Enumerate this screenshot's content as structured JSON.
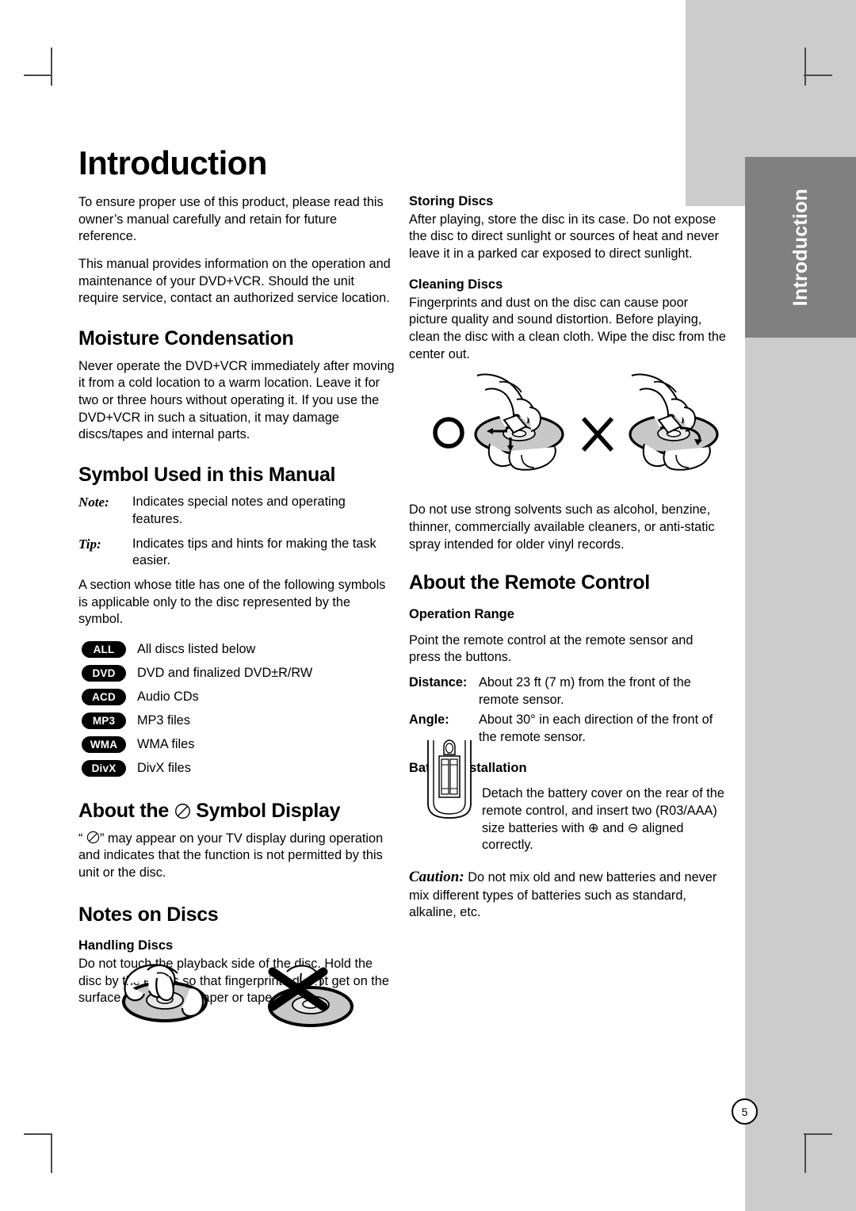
{
  "page": {
    "number": "5",
    "side_tab": "Introduction",
    "colors": {
      "tab_background": "#808080",
      "panel_gray": "#cccccc",
      "text": "#000000",
      "badge_background": "#000000",
      "badge_text": "#ffffff"
    }
  },
  "left_column": {
    "title": "Introduction",
    "intro_p1": "To ensure proper use of this product, please read this owner’s manual carefully and retain for future reference.",
    "intro_p2": "This manual provides information on the operation and maintenance of your DVD+VCR. Should the unit require service, contact an authorized service location.",
    "moisture": {
      "heading": "Moisture Condensation",
      "body": "Never operate the DVD+VCR immediately after moving it from a cold location to a warm location. Leave it for two or three hours without operating it. If you use the DVD+VCR in such a situation, it may damage discs/tapes and internal parts."
    },
    "symbol_manual": {
      "heading": "Symbol Used in this Manual",
      "definitions": [
        {
          "term": "Note:",
          "desc": "Indicates special notes and operating features."
        },
        {
          "term": "Tip:",
          "desc": "Indicates tips and hints for making the task easier."
        }
      ],
      "applicability": "A section whose title has one of the following symbols is applicable only to the disc represented by the symbol.",
      "badges": [
        {
          "code": "ALL",
          "desc": "All discs listed below"
        },
        {
          "code": "DVD",
          "desc": "DVD and finalized DVD±R/RW"
        },
        {
          "code": "ACD",
          "desc": "Audio CDs"
        },
        {
          "code": "MP3",
          "desc": "MP3 files"
        },
        {
          "code": "WMA",
          "desc": "WMA files"
        },
        {
          "code": "DivX",
          "desc": "DivX files"
        }
      ]
    },
    "symbol_display": {
      "heading_before": "About the",
      "heading_after": "Symbol Display",
      "body_before": "“",
      "body_after": "” may appear on your TV display during operation and indicates that the function is not permitted by this unit or the disc."
    },
    "notes_on_discs": {
      "heading": "Notes on Discs",
      "handling": {
        "heading": "Handling Discs",
        "body": "Do not touch the playback side of the disc. Hold the disc by the edges so that fingerprints do not get on the surface. Never stick paper or tape on the disc."
      }
    }
  },
  "right_column": {
    "storing": {
      "heading": "Storing Discs",
      "body": "After playing, store the disc in its case. Do not expose the disc to direct sunlight or sources of heat and never leave it in a parked car exposed to direct sunlight."
    },
    "cleaning": {
      "heading": "Cleaning Discs",
      "body": "Fingerprints and dust on the disc can cause poor picture quality and sound distortion. Before playing, clean the disc with a clean cloth. Wipe the disc from the center out.",
      "solvents": "Do not use strong solvents such as alcohol, benzine, thinner, commercially available cleaners, or anti-static spray intended for older vinyl records."
    },
    "remote": {
      "heading": "About the Remote Control",
      "operation_range": {
        "heading": "Operation Range",
        "body": "Point the remote control at the remote sensor and press the buttons.",
        "specs": [
          {
            "term": "Distance:",
            "desc": "About 23 ft (7 m) from the front of the remote sensor."
          },
          {
            "term": "Angle:",
            "desc": "About 30° in each direction of the front of the remote sensor."
          }
        ]
      },
      "battery": {
        "heading": "Battery installation",
        "body": "Detach the battery cover on the rear of the remote control, and insert two (R03/AAA) size batteries with ⊕ and ⊖ aligned correctly.",
        "caution_term": "Caution:",
        "caution_body": " Do not mix old and new batteries and never mix different types of batteries such as standard, alkaline, etc."
      }
    }
  }
}
